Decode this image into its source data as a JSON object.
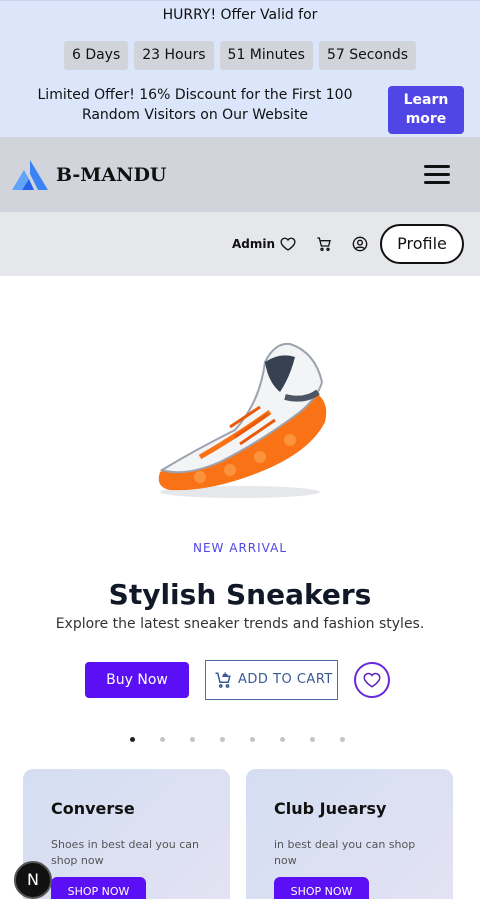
{
  "offer": {
    "title": "HURRY! Offer Valid for",
    "countdown": [
      "6 Days",
      "23 Hours",
      "51 Minutes",
      "57 Seconds"
    ],
    "text": "Limited Offer! 16% Discount for the First 100 Random Visitors on Our Website",
    "learn_more": "Learn more"
  },
  "navbar": {
    "brand": "B-MANDU",
    "logo_icon": "brand-logo-icon",
    "menu_icon": "hamburger-menu-icon"
  },
  "userbar": {
    "user": "Admin",
    "icons": [
      "heart-icon",
      "cart-icon",
      "user-circle-icon"
    ],
    "profile": "Profile"
  },
  "hero": {
    "tag": "NEW ARRIVAL",
    "title": "Stylish Sneakers",
    "subtitle": "Explore the latest sneaker trends and fashion styles.",
    "buy_now": "Buy Now",
    "add_to_cart": "ADD TO CART",
    "slide_count": 8,
    "active_slide": 1,
    "accent": "#5b0ff5"
  },
  "cards": [
    {
      "title": "Converse",
      "desc": "Shoes in best deal you can shop now",
      "cta": "SHOP NOW"
    },
    {
      "title": "Club Juearsy",
      "desc": "in best deal you can shop now",
      "cta": "SHOP NOW"
    }
  ],
  "badge": {
    "label": "N"
  }
}
